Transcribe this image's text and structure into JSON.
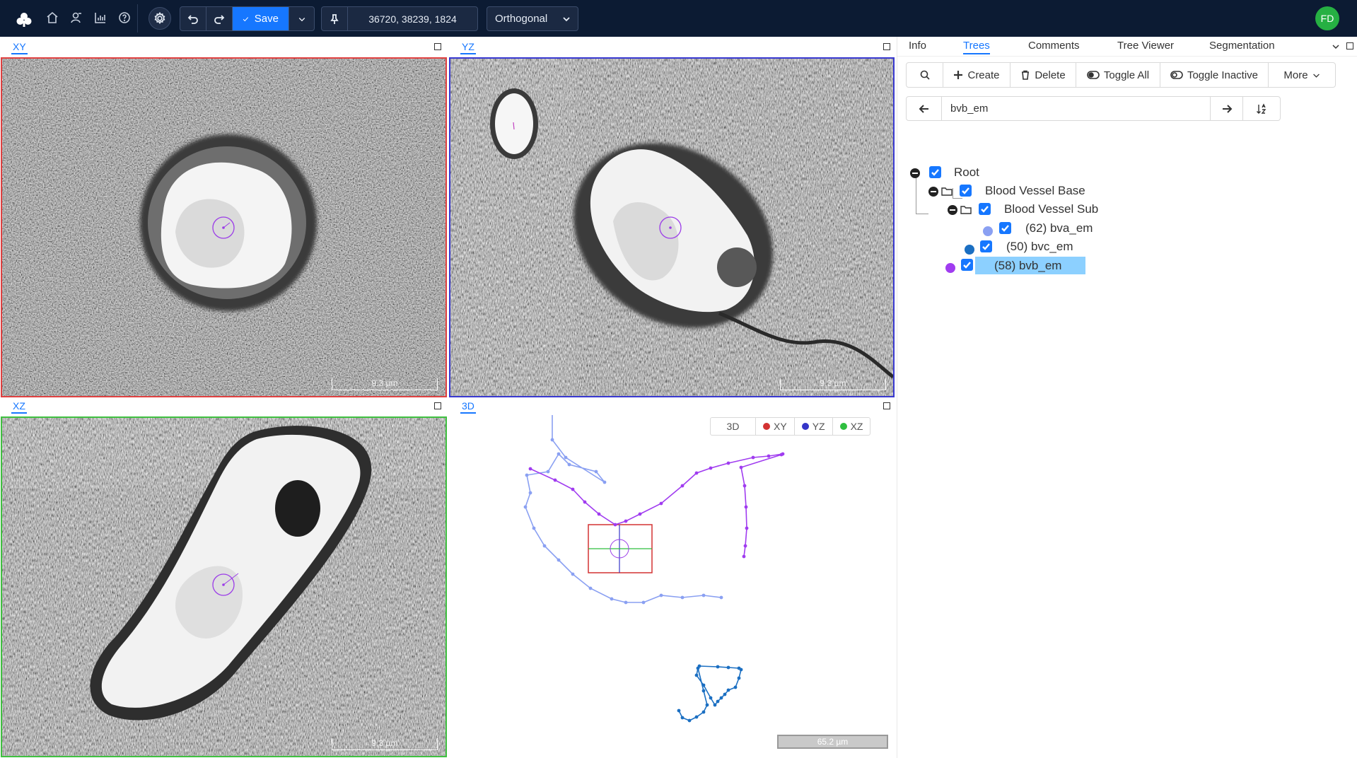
{
  "navbar": {
    "save_label": "Save",
    "position": "36720, 38239, 1824",
    "view_mode": "Orthogonal",
    "user_initials": "FD",
    "icons": [
      "home-icon",
      "user-icon",
      "statistics-icon",
      "help-icon",
      "settings-icon",
      "undo-icon",
      "redo-icon",
      "pin-icon"
    ]
  },
  "viewports": {
    "xy": {
      "label": "XY",
      "scale": "9.3 µm",
      "border_color": "#e04040"
    },
    "yz": {
      "label": "YZ",
      "scale": "9.3 µm",
      "border_color": "#3838d0"
    },
    "xz": {
      "label": "XZ",
      "scale": "9.3 µm",
      "border_color": "#3fc040"
    },
    "td": {
      "label": "3D",
      "scale": "65.2 µm",
      "legend": [
        {
          "label": "3D",
          "color": ""
        },
        {
          "label": "XY",
          "color": "#d33232"
        },
        {
          "label": "YZ",
          "color": "#3535c8"
        },
        {
          "label": "XZ",
          "color": "#2fbf3f"
        }
      ]
    }
  },
  "panel": {
    "tabs": [
      "Info",
      "Trees",
      "Comments",
      "Tree Viewer",
      "Segmentation"
    ],
    "active_tab": "Trees",
    "toolbar": {
      "create": "Create",
      "delete": "Delete",
      "toggle_all": "Toggle All",
      "toggle_inactive": "Toggle Inactive",
      "more": "More"
    },
    "search_value": "bvb_em",
    "tree": {
      "root": "Root",
      "group1": "Blood Vessel Base",
      "group2": "Blood Vessel Sub",
      "items": [
        {
          "label": "(62) bva_em",
          "color": "#8aa0f2"
        },
        {
          "label": "(50) bvc_em",
          "color": "#1b6fc2"
        },
        {
          "label": "(58) bvb_em",
          "color": "#a03cf0",
          "selected": true
        }
      ]
    }
  }
}
